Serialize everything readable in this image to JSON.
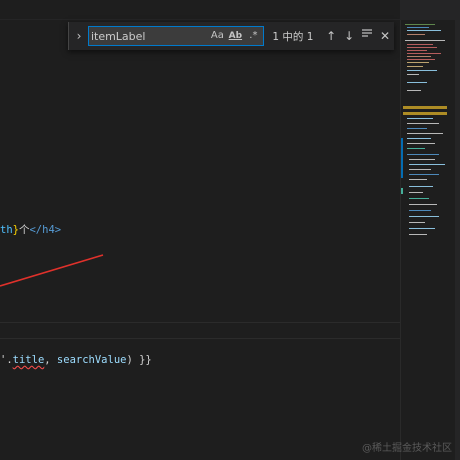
{
  "find_widget": {
    "query": "itemLabel",
    "match_case_label": "Aa",
    "whole_word_label": "Ab",
    "regex_label": ".*",
    "match_count": "1 中的 1",
    "toggle_icon": "chevron-right-icon",
    "prev_icon": "arrow-up-icon",
    "next_icon": "arrow-down-icon",
    "selection_icon": "find-in-selection-icon",
    "close_icon": "close-icon"
  },
  "code": {
    "line1": {
      "var": "th",
      "brace": "}",
      "text": "个",
      "close_open": "</",
      "tag": "h4",
      "close_end": ">"
    },
    "line2": {
      "prefix": "'.",
      "prop": "title",
      "sep": ", ",
      "arg": "searchValue",
      "suffix": ") }}"
    }
  },
  "colors": {
    "editor_bg": "#1e1e1e",
    "find_widget_bg": "#252526",
    "accent": "#007acc",
    "annotation_arrow": "#e0312b"
  },
  "watermark": "@稀土掘金技术社区"
}
